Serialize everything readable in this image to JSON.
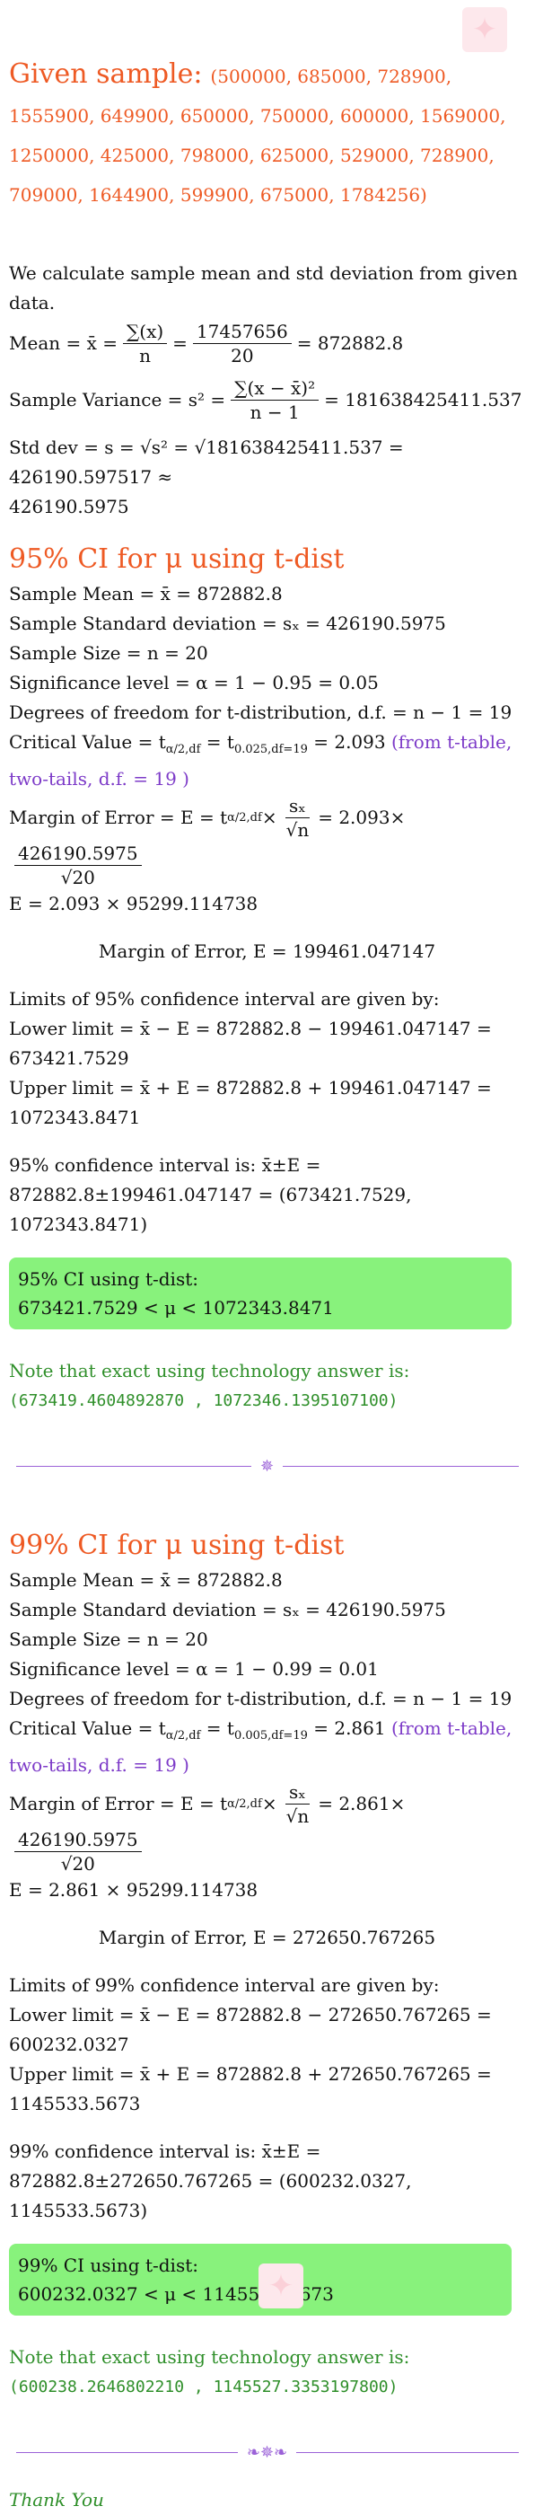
{
  "header": {
    "given_label": "Given sample:",
    "sample_values": "(500000, 685000, 728900, 1555900, 649900, 650000, 750000, 600000, 1569000, 1250000, 425000, 798000, 625000, 529000, 728900, 709000, 1644900, 599900, 675000, 1784256)"
  },
  "stats": {
    "intro": "We calculate sample mean and std deviation from given data.",
    "mean_lhs": "Mean = x̄ =",
    "mean_num": "∑(x)",
    "mean_den": "n",
    "mean_num2": "17457656",
    "mean_den2": "20",
    "mean_result": "= 872882.8",
    "var_lhs": "Sample Variance = s² =",
    "var_num": "∑(x − x̄)²",
    "var_den": "n − 1",
    "var_result": "= 181638425411.537",
    "sd_line1": "Std dev = s = √s² = √181638425411.537 = 426190.597517 ≈",
    "sd_line2": "426190.5975"
  },
  "ci95": {
    "title": "95% CI for μ using t-dist",
    "sample_mean": "Sample Mean = x̄ = 872882.8",
    "sample_sd": "Sample Standard deviation = sₓ = 426190.5975",
    "sample_size": "Sample Size = n = 20",
    "significance": "Significance level = α = 1 − 0.95 = 0.05",
    "dof": "Degrees of freedom for t-distribution, d.f. = n − 1 = 19",
    "critical": "Critical Value = t",
    "critical_sub": "α/2,df",
    "critical_mid": " = t",
    "critical_sub2": "0.025,df=19",
    "critical_val": " = 2.093",
    "critical_note": "(from t-table, two-tails, d.f. = 19 )",
    "moe_lhs": "Margin of Error = E = t",
    "moe_sub": "α/2,df",
    "moe_times": "×",
    "moe_frac_num": "sₓ",
    "moe_frac_den": "√n",
    "moe_eq": "= 2.093×",
    "moe_frac2_num": "426190.5975",
    "moe_frac2_den": "√20",
    "moe_line2": "E = 2.093 × 95299.114738",
    "moe_final": "Margin of Error, E = 199461.047147",
    "limits_intro": "Limits of 95% confidence interval are given by:",
    "lower": "Lower limit = x̄ − E = 872882.8 − 199461.047147 = 673421.7529",
    "upper": "Upper limit = x̄ + E = 872882.8 + 199461.047147 = 1072343.8471",
    "interval": "95% confidence interval is: x̄±E = 872882.8±199461.047147 = (673421.7529, 1072343.8471)",
    "box_title": "95% CI using t-dist:",
    "box_result": "673421.7529 < μ < 1072343.8471",
    "tech_note": "Note that exact using technology answer is:",
    "tech_value": "(673419.4604892870 , 1072346.1395107100)"
  },
  "ci99": {
    "title": "99% CI for μ using t-dist",
    "sample_mean": "Sample Mean = x̄ = 872882.8",
    "sample_sd": "Sample Standard deviation = sₓ = 426190.5975",
    "sample_size": "Sample Size = n = 20",
    "significance": "Significance level = α = 1 − 0.99 = 0.01",
    "dof": "Degrees of freedom for t-distribution, d.f. = n − 1 = 19",
    "critical": "Critical Value = t",
    "critical_sub": "α/2,df",
    "critical_mid": " = t",
    "critical_sub2": "0.005,df=19",
    "critical_val": " = 2.861",
    "critical_note": "(from t-table, two-tails, d.f. = 19 )",
    "moe_lhs": "Margin of Error = E = t",
    "moe_sub": "α/2,df",
    "moe_times": "×",
    "moe_frac_num": "sₓ",
    "moe_frac_den": "√n",
    "moe_eq": "= 2.861×",
    "moe_frac2_num": "426190.5975",
    "moe_frac2_den": "√20",
    "moe_line2": "E = 2.861 × 95299.114738",
    "moe_final": "Margin of Error, E = 272650.767265",
    "limits_intro": "Limits of 99% confidence interval are given by:",
    "lower": "Lower limit = x̄ − E = 872882.8 − 272650.767265 = 600232.0327",
    "upper": "Upper limit = x̄ + E = 872882.8 + 272650.767265 = 1145533.5673",
    "interval": "99% confidence interval is: x̄±E = 872882.8±272650.767265 = (600232.0327, 1145533.5673)",
    "box_title": "99% CI using t-dist:",
    "box_result": "600232.0327 < μ < 1145533.5673",
    "tech_note": "Note that exact using technology answer is:",
    "tech_value": "(600238.2646802210 , 1145527.3353197800)"
  },
  "separators": {
    "ornament1": "✵",
    "ornament2": "❧✵❧"
  },
  "footer": {
    "thanks": "Thank You"
  },
  "colors": {
    "heading": "#ee5a24",
    "accent": "#7d3bc8",
    "note": "#2f8f2a",
    "box": "#88f27c"
  }
}
